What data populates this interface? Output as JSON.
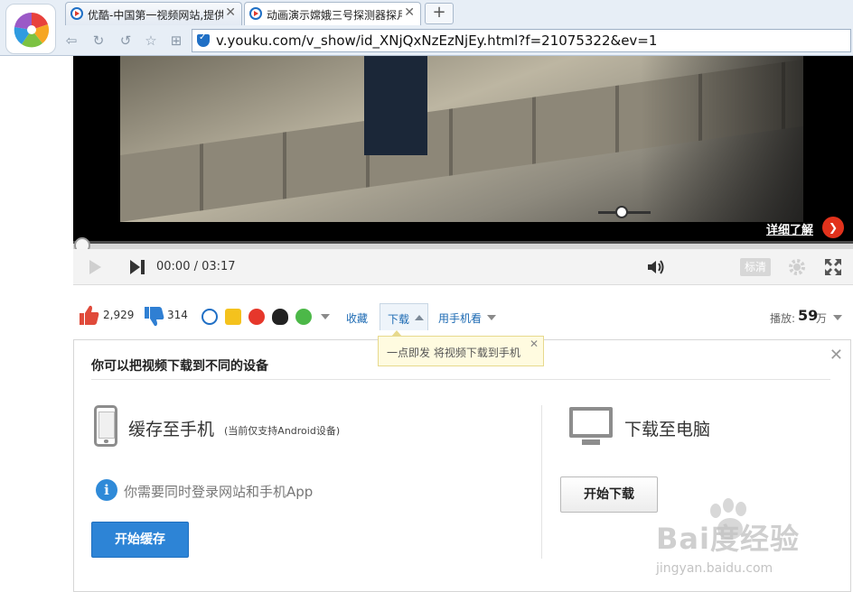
{
  "browser": {
    "tabs": [
      {
        "title": "优酷-中国第一视频网站,提供",
        "close": "✕"
      },
      {
        "title": "动画演示嫦娥三号探测器探月",
        "close": "✕"
      }
    ],
    "new_tab": "+",
    "nav": {
      "back": "⇦",
      "refresh": "↻",
      "undo": "↺",
      "favorite": "☆",
      "apps": "⊞"
    },
    "address": "v.youku.com/v_show/id_XNjQxNzEzNjEy.html?f=21075322&ev=1"
  },
  "player": {
    "learn_more": "详细了解",
    "learn_more_icon": "❯",
    "time": "00:00 / 03:17",
    "progress": 0,
    "volume_level": 0.45,
    "quality": "标清"
  },
  "actions": {
    "likes": "2,929",
    "dislikes": "314",
    "favorite": "收藏",
    "download": "下载",
    "watch_on_phone": "用手机看",
    "views_label": "播放:",
    "views_value": "59",
    "views_unit": "万"
  },
  "tooltip": {
    "text": "一点即发 将视频下载到手机",
    "close": "✕"
  },
  "download_panel": {
    "title": "你可以把视频下载到不同的设备",
    "close": "✕",
    "phone": {
      "heading": "缓存至手机",
      "note": "(当前仅支持Android设备)",
      "info": "你需要同时登录网站和手机App",
      "info_icon": "i",
      "button": "开始缓存"
    },
    "computer": {
      "heading": "下载至电脑",
      "button": "开始下载"
    }
  },
  "watermark": {
    "text": "Bai度经验",
    "url": "jingyan.baidu.com"
  },
  "colors": {
    "accent_blue": "#2d84d6",
    "link_blue": "#1c6ab3",
    "youku_red": "#e2321c",
    "tooltip_bg": "#fffbe0"
  },
  "icons": [
    "browser-logo-icon",
    "youku-tab-icon",
    "security-shield-icon",
    "play-icon",
    "next-icon",
    "volume-icon",
    "gear-icon",
    "fullscreen-icon",
    "thumbs-up-icon",
    "thumbs-down-icon",
    "youku-share-icon",
    "qzone-share-icon",
    "weibo-share-icon",
    "qq-share-icon",
    "wechat-share-icon",
    "phone-icon",
    "info-icon",
    "computer-icon"
  ]
}
